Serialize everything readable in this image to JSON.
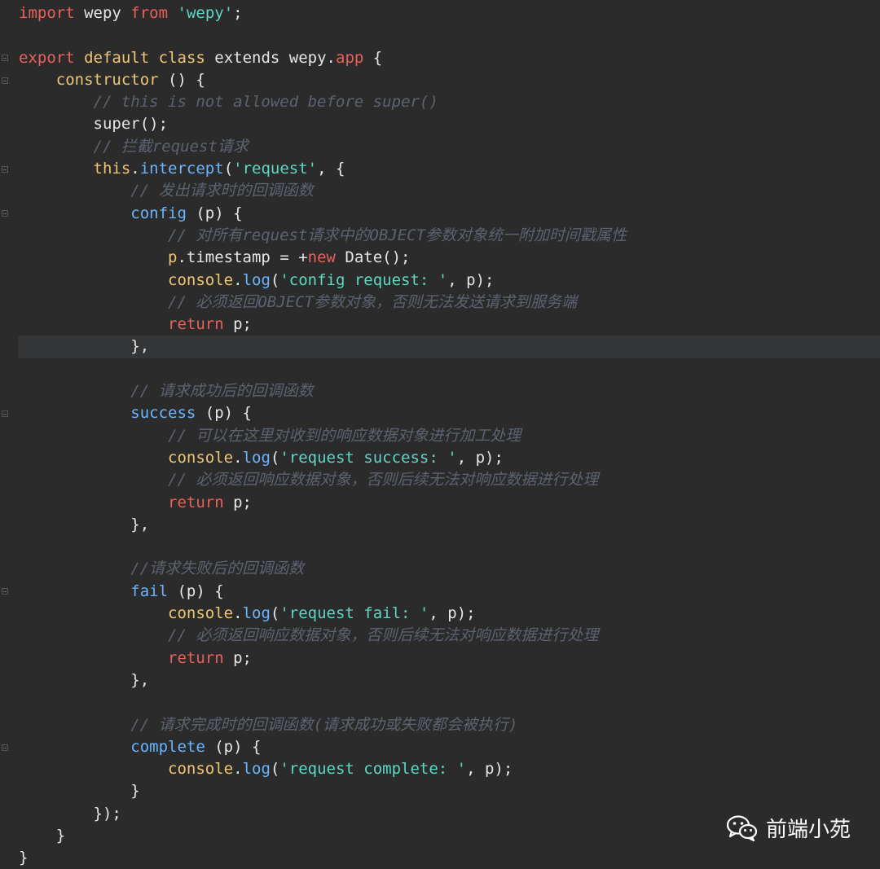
{
  "editor": {
    "lines": [
      {
        "tokens": [
          {
            "t": "import",
            "c": "kw"
          },
          {
            "t": " wepy ",
            "c": "pl"
          },
          {
            "t": "from",
            "c": "kw"
          },
          {
            "t": " ",
            "c": "pl"
          },
          {
            "t": "'wepy'",
            "c": "str"
          },
          {
            "t": ";",
            "c": "pl"
          }
        ]
      },
      {
        "tokens": []
      },
      {
        "fold": true,
        "tokens": [
          {
            "t": "export",
            "c": "kw"
          },
          {
            "t": " ",
            "c": "pl"
          },
          {
            "t": "default",
            "c": "cls"
          },
          {
            "t": " ",
            "c": "pl"
          },
          {
            "t": "class",
            "c": "cls"
          },
          {
            "t": " ",
            "c": "pl"
          },
          {
            "t": "extends",
            "c": "pl"
          },
          {
            "t": " wepy.",
            "c": "pl"
          },
          {
            "t": "app",
            "c": "kw"
          },
          {
            "t": " {",
            "c": "pl"
          }
        ]
      },
      {
        "fold": true,
        "tokens": [
          {
            "t": "    ",
            "c": "pl"
          },
          {
            "t": "constructor",
            "c": "cls"
          },
          {
            "t": " () {",
            "c": "pl"
          }
        ]
      },
      {
        "tokens": [
          {
            "t": "        ",
            "c": "pl"
          },
          {
            "t": "// this is not allowed before super()",
            "c": "cm"
          }
        ]
      },
      {
        "tokens": [
          {
            "t": "        super();",
            "c": "pl"
          }
        ]
      },
      {
        "tokens": [
          {
            "t": "        ",
            "c": "pl"
          },
          {
            "t": "// 拦截request请求",
            "c": "cm"
          }
        ]
      },
      {
        "fold": true,
        "tokens": [
          {
            "t": "        ",
            "c": "pl"
          },
          {
            "t": "this",
            "c": "cls"
          },
          {
            "t": ".",
            "c": "pl"
          },
          {
            "t": "intercept",
            "c": "fn"
          },
          {
            "t": "(",
            "c": "pl"
          },
          {
            "t": "'request'",
            "c": "str"
          },
          {
            "t": ", {",
            "c": "pl"
          }
        ]
      },
      {
        "tokens": [
          {
            "t": "            ",
            "c": "pl"
          },
          {
            "t": "// 发出请求时的回调函数",
            "c": "cm"
          }
        ]
      },
      {
        "fold": true,
        "tokens": [
          {
            "t": "            ",
            "c": "pl"
          },
          {
            "t": "config",
            "c": "fn"
          },
          {
            "t": " (p) {",
            "c": "pl"
          }
        ]
      },
      {
        "tokens": [
          {
            "t": "                ",
            "c": "pl"
          },
          {
            "t": "// 对所有request请求中的OBJECT参数对象统一附加时间戳属性",
            "c": "cm"
          }
        ]
      },
      {
        "tokens": [
          {
            "t": "                ",
            "c": "pl"
          },
          {
            "t": "p",
            "c": "cls"
          },
          {
            "t": ".timestamp = +",
            "c": "pl"
          },
          {
            "t": "new",
            "c": "kw"
          },
          {
            "t": " Date();",
            "c": "pl"
          }
        ]
      },
      {
        "tokens": [
          {
            "t": "                ",
            "c": "pl"
          },
          {
            "t": "console",
            "c": "cls"
          },
          {
            "t": ".",
            "c": "pl"
          },
          {
            "t": "log",
            "c": "fn"
          },
          {
            "t": "(",
            "c": "pl"
          },
          {
            "t": "'config request: '",
            "c": "str"
          },
          {
            "t": ", p);",
            "c": "pl"
          }
        ]
      },
      {
        "tokens": [
          {
            "t": "                ",
            "c": "pl"
          },
          {
            "t": "// 必须返回OBJECT参数对象，否则无法发送请求到服务端",
            "c": "cm"
          }
        ]
      },
      {
        "tokens": [
          {
            "t": "                ",
            "c": "pl"
          },
          {
            "t": "return",
            "c": "kw"
          },
          {
            "t": " p;",
            "c": "pl"
          }
        ]
      },
      {
        "tokens": [
          {
            "t": "            },",
            "c": "pl"
          }
        ]
      },
      {
        "tokens": []
      },
      {
        "tokens": [
          {
            "t": "            ",
            "c": "pl"
          },
          {
            "t": "// 请求成功后的回调函数",
            "c": "cm"
          }
        ]
      },
      {
        "fold": true,
        "tokens": [
          {
            "t": "            ",
            "c": "pl"
          },
          {
            "t": "success",
            "c": "fn"
          },
          {
            "t": " (p) {",
            "c": "pl"
          }
        ]
      },
      {
        "tokens": [
          {
            "t": "                ",
            "c": "pl"
          },
          {
            "t": "// 可以在这里对收到的响应数据对象进行加工处理",
            "c": "cm"
          }
        ]
      },
      {
        "tokens": [
          {
            "t": "                ",
            "c": "pl"
          },
          {
            "t": "console",
            "c": "cls"
          },
          {
            "t": ".",
            "c": "pl"
          },
          {
            "t": "log",
            "c": "fn"
          },
          {
            "t": "(",
            "c": "pl"
          },
          {
            "t": "'request success: '",
            "c": "str"
          },
          {
            "t": ", p);",
            "c": "pl"
          }
        ]
      },
      {
        "tokens": [
          {
            "t": "                ",
            "c": "pl"
          },
          {
            "t": "// 必须返回响应数据对象，否则后续无法对响应数据进行处理",
            "c": "cm"
          }
        ]
      },
      {
        "tokens": [
          {
            "t": "                ",
            "c": "pl"
          },
          {
            "t": "return",
            "c": "kw"
          },
          {
            "t": " p;",
            "c": "pl"
          }
        ]
      },
      {
        "tokens": [
          {
            "t": "            },",
            "c": "pl"
          }
        ]
      },
      {
        "tokens": []
      },
      {
        "tokens": [
          {
            "t": "            ",
            "c": "pl"
          },
          {
            "t": "//请求失败后的回调函数",
            "c": "cm"
          }
        ]
      },
      {
        "fold": true,
        "tokens": [
          {
            "t": "            ",
            "c": "pl"
          },
          {
            "t": "fail",
            "c": "fn"
          },
          {
            "t": " (p) {",
            "c": "pl"
          }
        ]
      },
      {
        "tokens": [
          {
            "t": "                ",
            "c": "pl"
          },
          {
            "t": "console",
            "c": "cls"
          },
          {
            "t": ".",
            "c": "pl"
          },
          {
            "t": "log",
            "c": "fn"
          },
          {
            "t": "(",
            "c": "pl"
          },
          {
            "t": "'request fail: '",
            "c": "str"
          },
          {
            "t": ", p);",
            "c": "pl"
          }
        ]
      },
      {
        "tokens": [
          {
            "t": "                ",
            "c": "pl"
          },
          {
            "t": "// 必须返回响应数据对象，否则后续无法对响应数据进行处理",
            "c": "cm"
          }
        ]
      },
      {
        "tokens": [
          {
            "t": "                ",
            "c": "pl"
          },
          {
            "t": "return",
            "c": "kw"
          },
          {
            "t": " p;",
            "c": "pl"
          }
        ]
      },
      {
        "tokens": [
          {
            "t": "            },",
            "c": "pl"
          }
        ]
      },
      {
        "tokens": []
      },
      {
        "tokens": [
          {
            "t": "            ",
            "c": "pl"
          },
          {
            "t": "// 请求完成时的回调函数(请求成功或失败都会被执行)",
            "c": "cm"
          }
        ]
      },
      {
        "fold": true,
        "tokens": [
          {
            "t": "            ",
            "c": "pl"
          },
          {
            "t": "complete",
            "c": "fn"
          },
          {
            "t": " (p) {",
            "c": "pl"
          }
        ]
      },
      {
        "tokens": [
          {
            "t": "                ",
            "c": "pl"
          },
          {
            "t": "console",
            "c": "cls"
          },
          {
            "t": ".",
            "c": "pl"
          },
          {
            "t": "log",
            "c": "fn"
          },
          {
            "t": "(",
            "c": "pl"
          },
          {
            "t": "'request complete: '",
            "c": "str"
          },
          {
            "t": ", p);",
            "c": "pl"
          }
        ]
      },
      {
        "tokens": [
          {
            "t": "            }",
            "c": "pl"
          }
        ]
      },
      {
        "tokens": [
          {
            "t": "        });",
            "c": "pl"
          }
        ]
      },
      {
        "tokens": [
          {
            "t": "    }",
            "c": "pl"
          }
        ]
      },
      {
        "tokens": [
          {
            "t": "}",
            "c": "pl"
          }
        ]
      }
    ]
  },
  "colors": {
    "background": "#2b2b2b",
    "keyword": "#e8615a",
    "string": "#5fd7c2",
    "function": "#69b5ff",
    "class": "#f0c674",
    "comment": "#5c6370"
  },
  "watermark": {
    "icon": "wechat-icon",
    "text": "前端小苑"
  }
}
